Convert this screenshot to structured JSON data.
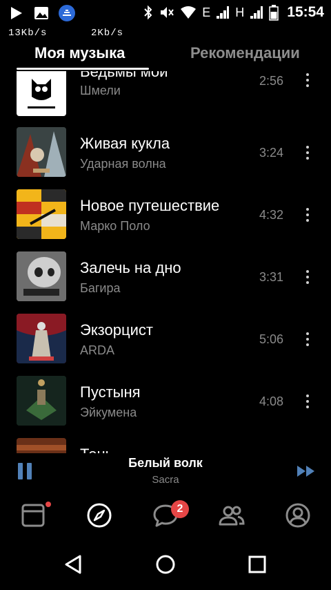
{
  "status_bar": {
    "time": "15:54",
    "speed_up": "13Kb/s",
    "speed_down": "2Kb/s",
    "network_e": "E",
    "network_h": "H",
    "icons": [
      "play-icon",
      "image-icon",
      "vk-icon",
      "bluetooth-icon",
      "mute-icon",
      "wifi-icon",
      "signal-icon",
      "battery-icon"
    ]
  },
  "tabs": {
    "active": "Моя музыка",
    "inactive": "Рекомендации"
  },
  "tracks": [
    {
      "title": "Ведьмы мои",
      "artist": "Шмели",
      "duration": "2:56",
      "cover_color": "#ffffff"
    },
    {
      "title": "Живая кукла",
      "artist": "Ударная волна",
      "duration": "3:24",
      "cover_color": "#2b3a3a"
    },
    {
      "title": "Новое путешествие",
      "artist": "Марко Поло",
      "duration": "4:32",
      "cover_color": "#f4b81c"
    },
    {
      "title": "Залечь на дно",
      "artist": "Багира",
      "duration": "3:31",
      "cover_color": "#777777"
    },
    {
      "title": "Экзорцист",
      "artist": "ARDA",
      "duration": "5:06",
      "cover_color": "#7a1420"
    },
    {
      "title": "Пустыня",
      "artist": "Эйкумена",
      "duration": "4:08",
      "cover_color": "#1d3a2c"
    },
    {
      "title": "Тень",
      "artist": "",
      "duration": "",
      "cover_color": "#5a2a1a"
    }
  ],
  "player": {
    "title": "Белый волк",
    "artist": "Sacra"
  },
  "nav": {
    "messages_badge": "2"
  },
  "colors": {
    "accent": "#5181b8",
    "badge": "#e64646",
    "secondary_text": "#8a8a8a"
  }
}
